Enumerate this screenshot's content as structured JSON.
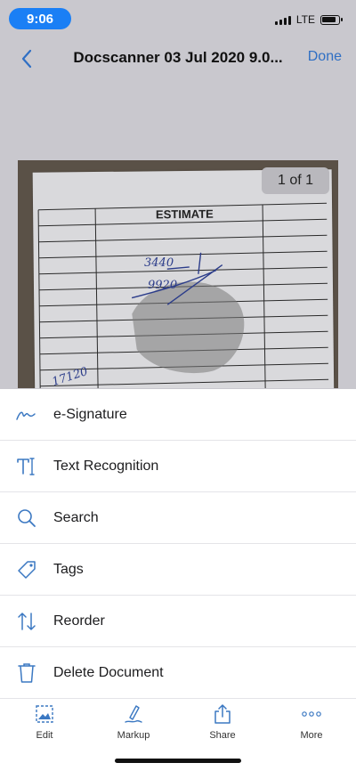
{
  "status": {
    "time": "9:06",
    "network": "LTE"
  },
  "nav": {
    "title": "Docscanner 03 Jul 2020 9.0...",
    "done_label": "Done"
  },
  "document": {
    "page_counter": "1 of 1",
    "heading": "ESTIMATE",
    "handwriting": [
      "3440",
      "9920",
      "17120"
    ]
  },
  "menu": [
    {
      "label": "e-Signature",
      "icon": "signature-icon"
    },
    {
      "label": "Text Recognition",
      "icon": "text-recognition-icon"
    },
    {
      "label": "Search",
      "icon": "search-icon"
    },
    {
      "label": "Tags",
      "icon": "tag-icon"
    },
    {
      "label": "Reorder",
      "icon": "reorder-icon"
    },
    {
      "label": "Delete Document",
      "icon": "trash-icon"
    }
  ],
  "tabs": [
    {
      "label": "Edit",
      "icon": "crop-icon"
    },
    {
      "label": "Markup",
      "icon": "pen-icon"
    },
    {
      "label": "Share",
      "icon": "share-icon"
    },
    {
      "label": "More",
      "icon": "more-icon"
    }
  ],
  "colors": {
    "accent": "#2f6fc4",
    "time_pill": "#1a7ff5",
    "icon": "#3b78c2"
  }
}
